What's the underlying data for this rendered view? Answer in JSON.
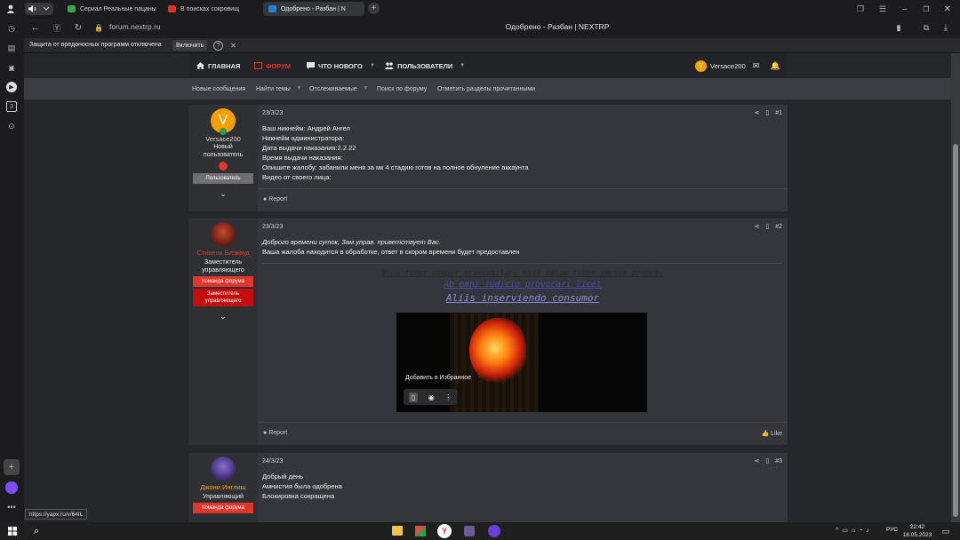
{
  "browser": {
    "tabs": [
      {
        "label": "Сериал Реальные пацаны",
        "color": "#3fa34d",
        "fav_text": "ТНТ"
      },
      {
        "label": "В поисках сокровищ",
        "color": "#e52d27",
        "fav_text": "▶"
      },
      {
        "label": "Одобрено - Разбан | N",
        "color": "#2a7fd4",
        "fav_text": "N"
      }
    ],
    "url": "forum.nextrp.ru",
    "page_title": "Одобрено - Разбан | NEXTRP",
    "infobar": {
      "text": "Защита от вредоносных программ отключена",
      "button": "Включить"
    },
    "status_url": "https://yapx.ru/v/64IL"
  },
  "navbar": {
    "items": [
      {
        "label": "ГЛАВНАЯ",
        "icon": "home-icon",
        "active": false
      },
      {
        "label": "ФОРУМ",
        "icon": "forum-icon",
        "active": true
      },
      {
        "label": "ЧТО НОВОГО",
        "icon": "chat-icon",
        "active": false
      },
      {
        "label": "ПОЛЬЗОВАТЕЛИ",
        "icon": "users-icon",
        "active": false
      }
    ],
    "user": "Versace200"
  },
  "subnav": [
    "Новые сообщения",
    "Найти темы",
    "Отслеживаемые",
    "Поиск по форуму",
    "Отметить разделы прочитанными"
  ],
  "posts": [
    {
      "user": {
        "name": "Versace200",
        "name_color": "#d6d6d6",
        "avatar_letter": "V",
        "title": "Новый пользователь",
        "badges": [
          {
            "label": "Пользователь",
            "bg": "#6f6f73"
          }
        ]
      },
      "date": "23/3/23",
      "num": "#1",
      "lines": [
        "Ваш никнейм: Андрей Ангел",
        "Никнейм администратора:",
        "Дата выдачи наказания:2.2.22",
        "Время выдачи наказания:",
        "Опишите жалобу: забанили меня за мк 4 стадию готов на полное обнуление аккаунта",
        "Видео от своего лица:"
      ],
      "footer": {
        "report": "Report"
      }
    },
    {
      "user": {
        "name": "Стивени Блэквуд",
        "name_color": "#e03a2e",
        "title": "Заместитель управляющего",
        "badges": [
          {
            "label": "Команда форума",
            "bg": "#e0362b"
          },
          {
            "label": "Заместитель управляющего",
            "bg": "#c40d0d"
          }
        ]
      },
      "date": "23/3/23",
      "num": "#2",
      "lines_italic": "Доброго времени суток, Зам.управ. приветствует Вас.",
      "lines": [
        "Ваша жалоба находится в обработке, ответ в скором времени будет предоставлен"
      ],
      "signature": [
        "Bona fides semper praesumitur, nisi malam fidem adesse probetu",
        "Ab omni iudicio provocari licet",
        "Aliis inserviendo consumor"
      ],
      "image_tooltip": "Добавить в Избранное",
      "footer": {
        "report": "Report",
        "like": "Like"
      }
    },
    {
      "user": {
        "name": "Джони Инглиш",
        "name_color": "#f0a323",
        "title": "Управляющий",
        "badges": [
          {
            "label": "Команда форума",
            "bg": "#e0362b"
          }
        ]
      },
      "date": "24/3/23",
      "num": "#3",
      "lines": [
        "Добрый день",
        "Амнистия была одобрена",
        "Блокировка сокращена"
      ]
    }
  ],
  "taskbar": {
    "lang": "РУС",
    "time": "22:42",
    "date": "18.05.2023"
  }
}
